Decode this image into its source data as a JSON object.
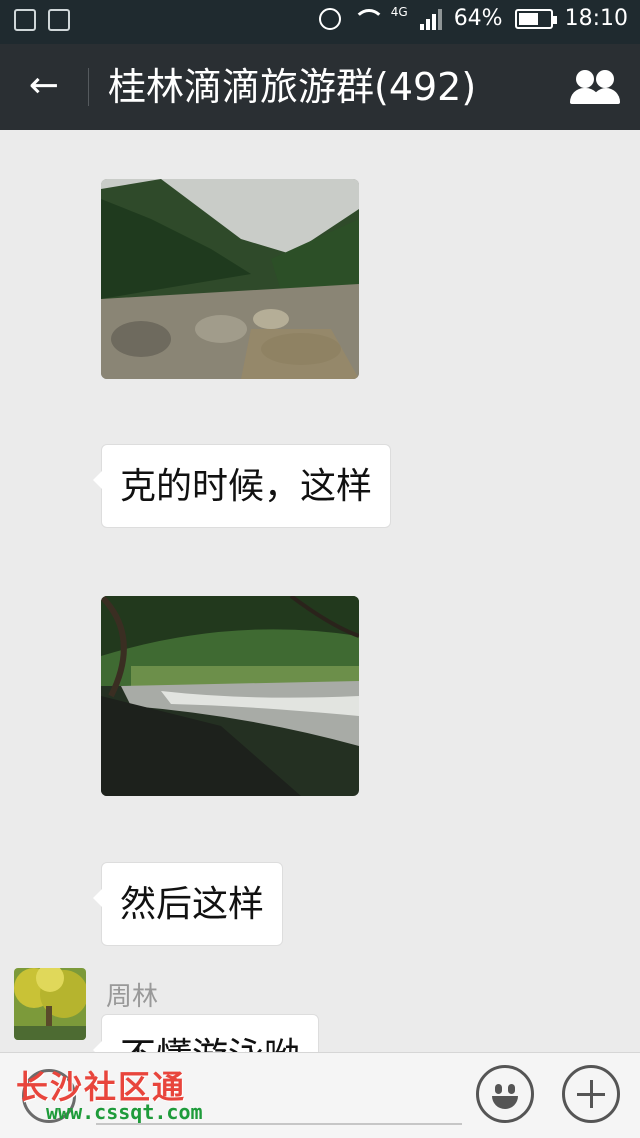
{
  "status_bar": {
    "network": "4G",
    "battery": "64%",
    "battery_level": 0.64,
    "time": "18:10"
  },
  "header": {
    "title": "桂林滴滴旅游群(492)"
  },
  "messages": {
    "m2_text": "克的时候，这样",
    "m4_text": "然后这样",
    "m5_sender": "周林",
    "m5_text": "不懂游泳呦"
  },
  "watermark": {
    "text": "长沙社区通",
    "url": "www.cssqt.com"
  },
  "icons": {
    "back": "arrow-left-icon",
    "members": "group-members-icon",
    "voice": "voice-input-icon",
    "emoji": "emoji-icon",
    "more": "plus-icon"
  }
}
